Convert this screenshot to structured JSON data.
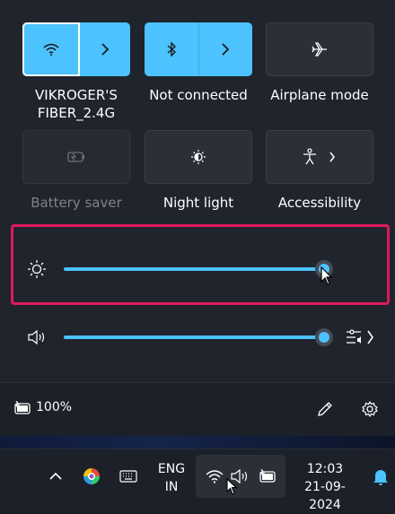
{
  "quick_settings": {
    "tiles": [
      {
        "label": "VIKROGER'S",
        "label2": "FIBER_2.4G",
        "icon": "wifi-icon",
        "state": "on"
      },
      {
        "label": "Not connected",
        "icon": "bluetooth-icon",
        "state": "on"
      },
      {
        "label": "Airplane mode",
        "icon": "airplane-icon",
        "state": "off"
      },
      {
        "label": "Battery saver",
        "icon": "battery-saver-icon",
        "state": "disabled"
      },
      {
        "label": "Night light",
        "icon": "night-light-icon",
        "state": "off"
      },
      {
        "label": "Accessibility",
        "icon": "accessibility-icon",
        "state": "off"
      }
    ],
    "brightness": {
      "icon": "brightness-icon",
      "level_percent": 100
    },
    "volume": {
      "icon": "speaker-icon",
      "level_percent": 100,
      "mixer_icon": "volume-mixer-icon"
    },
    "footer": {
      "battery_text": "100%",
      "battery_icon": "battery-charging-icon",
      "edit_icon": "pencil-icon",
      "settings_icon": "gear-icon"
    }
  },
  "taskbar": {
    "language_line1": "ENG",
    "language_line2": "IN",
    "time": "12:03",
    "date": "21-09-2024",
    "icons": [
      "chevron-up-icon",
      "app-icon",
      "keyboard-icon",
      "wifi-icon",
      "speaker-icon",
      "battery-charging-icon",
      "bell-icon"
    ]
  },
  "colors": {
    "accent": "#4cc2ff",
    "highlight": "#e1195c",
    "panel": "#20242d"
  }
}
